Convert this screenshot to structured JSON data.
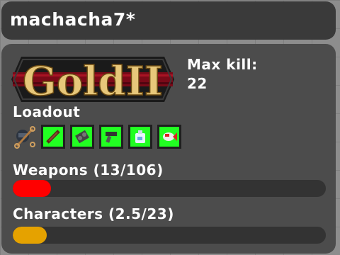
{
  "player": {
    "name": "machacha7*"
  },
  "badge": {
    "text": "GoldII"
  },
  "stats": {
    "max_kill_label": "Max kill:",
    "max_kill_value": "22"
  },
  "loadout": {
    "label": "Loadout",
    "slot_icons": [
      "sword-icon",
      "crossbow-icon",
      "gun-icon",
      "potion-icon",
      "fish-icon"
    ]
  },
  "progress": {
    "weapons": {
      "label": "Weapons (13/106)",
      "fraction": 0.1226,
      "color": "#ff0000"
    },
    "characters": {
      "label": "Characters (2.5/23)",
      "fraction": 0.1087,
      "color": "#e5a200"
    }
  },
  "colors": {
    "slot_background": "#22ff22",
    "panel": "#4c4c4c",
    "name_bar": "#3a3a3a"
  }
}
